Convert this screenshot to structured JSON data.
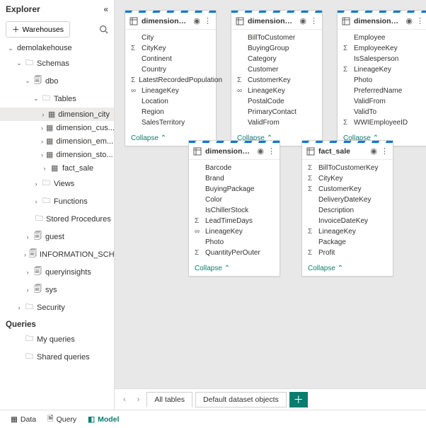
{
  "sidebar": {
    "title": "Explorer",
    "warehouses_btn": "Warehouses",
    "root": "demolakehouse",
    "schemas": "Schemas",
    "dbo": "dbo",
    "tables": "Tables",
    "table_items": [
      "dimension_city",
      "dimension_cus...",
      "dimension_em...",
      "dimension_sto...",
      "fact_sale"
    ],
    "views": "Views",
    "functions": "Functions",
    "sprocs": "Stored Procedures",
    "guest": "guest",
    "info": "INFORMATION_SCHEMA",
    "qi": "queryinsights",
    "sys": "sys",
    "security": "Security",
    "queries": "Queries",
    "myq": "My queries",
    "sharedq": "Shared queries"
  },
  "cards": [
    {
      "name": "dimension_city",
      "fields": [
        [
          "",
          "City"
        ],
        [
          "Σ",
          "CityKey"
        ],
        [
          "",
          "Continent"
        ],
        [
          "",
          "Country"
        ],
        [
          "Σ",
          "LatestRecordedPopulation"
        ],
        [
          "∞",
          "LineageKey"
        ],
        [
          "",
          "Location"
        ],
        [
          "",
          "Region"
        ],
        [
          "",
          "SalesTerritory"
        ]
      ]
    },
    {
      "name": "dimension_customer",
      "fields": [
        [
          "",
          "BillToCustomer"
        ],
        [
          "",
          "BuyingGroup"
        ],
        [
          "",
          "Category"
        ],
        [
          "",
          "Customer"
        ],
        [
          "Σ",
          "CustomerKey"
        ],
        [
          "∞",
          "LineageKey"
        ],
        [
          "",
          "PostalCode"
        ],
        [
          "",
          "PrimaryContact"
        ],
        [
          "",
          "ValidFrom"
        ]
      ]
    },
    {
      "name": "dimension_employee",
      "fields": [
        [
          "",
          "Employee"
        ],
        [
          "Σ",
          "EmployeeKey"
        ],
        [
          "",
          "IsSalesperson"
        ],
        [
          "Σ",
          "LineageKey"
        ],
        [
          "",
          "Photo"
        ],
        [
          "",
          "PreferredName"
        ],
        [
          "",
          "ValidFrom"
        ],
        [
          "",
          "ValidTo"
        ],
        [
          "Σ",
          "WWIEmployeeID"
        ]
      ]
    },
    {
      "name": "dimension_stock_item",
      "fields": [
        [
          "",
          "Barcode"
        ],
        [
          "",
          "Brand"
        ],
        [
          "",
          "BuyingPackage"
        ],
        [
          "",
          "Color"
        ],
        [
          "",
          "IsChillerStock"
        ],
        [
          "Σ",
          "LeadTimeDays"
        ],
        [
          "∞",
          "LineageKey"
        ],
        [
          "",
          "Photo"
        ],
        [
          "Σ",
          "QuantityPerOuter"
        ]
      ]
    },
    {
      "name": "fact_sale",
      "fields": [
        [
          "Σ",
          "BillToCustomerKey"
        ],
        [
          "Σ",
          "CityKey"
        ],
        [
          "Σ",
          "CustomerKey"
        ],
        [
          "",
          "DeliveryDateKey"
        ],
        [
          "",
          "Description"
        ],
        [
          "",
          "InvoiceDateKey"
        ],
        [
          "Σ",
          "LineageKey"
        ],
        [
          "",
          "Package"
        ],
        [
          "Σ",
          "Profit"
        ]
      ]
    }
  ],
  "collapse": "Collapse",
  "tabs": {
    "all": "All tables",
    "default": "Default dataset objects"
  },
  "footer": {
    "data": "Data",
    "query": "Query",
    "model": "Model"
  }
}
